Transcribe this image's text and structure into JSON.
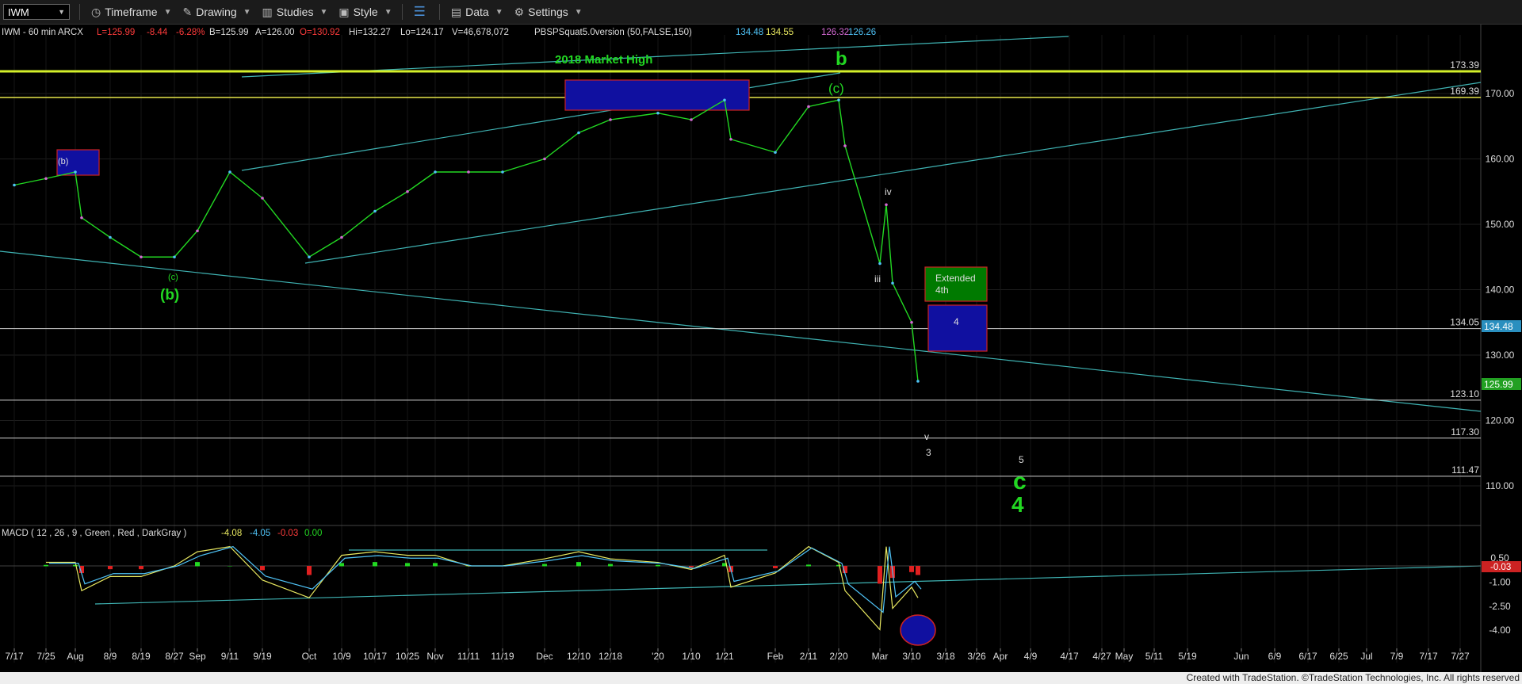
{
  "toolbar": {
    "symbol": "IWM",
    "timeframe": "Timeframe",
    "drawing": "Drawing",
    "studies": "Studies",
    "style": "Style",
    "data": "Data",
    "settings": "Settings"
  },
  "header": {
    "symbol_info": "IWM - 60 min  ARCX",
    "last": "L=125.99",
    "change": "-8.44",
    "pct": "-6.28%",
    "bid": "B=125.99",
    "ask": "A=126.00",
    "open": "O=130.92",
    "high": "Hi=132.27",
    "low": "Lo=124.17",
    "volume": "V=46,678,072",
    "study": "PBSPSquat5.0version (50,FALSE,150)",
    "v1": "134.48",
    "v2": "134.55",
    "v3": "126.32",
    "v4": "126.26"
  },
  "annotations": {
    "market_high": "2018 Market High",
    "b": "b",
    "c_paren": "(c)",
    "b_paren_small": "(b)",
    "c_small": "(c)",
    "b_paren_big": "(b)",
    "iv": "iv",
    "iii": "iii",
    "v": "v",
    "three": "3",
    "five": "5",
    "c_big": "c",
    "four_big": "4",
    "extended": "Extended",
    "fourth": "4th",
    "four_box": "4"
  },
  "level_labels": [
    "173.39",
    "169.39",
    "134.05",
    "123.10",
    "117.30",
    "111.47"
  ],
  "current_price": "125.99",
  "ref_price": "134.48",
  "macd": {
    "header": "MACD ( 12 , 26 , 9 , Green , Red , DarkGray )",
    "v1": "-4.08",
    "v2": "-4.05",
    "v3": "-0.03",
    "v4": "0.00",
    "current": "-0.03",
    "axis": [
      "0.50",
      "-1.00",
      "-2.50",
      "-4.00"
    ]
  },
  "footer": "Created with TradeStation. ©TradeStation Technologies, Inc. All rights reserved",
  "chart_data": {
    "type": "line",
    "symbol": "IWM",
    "interval": "60 min",
    "ylim": [
      105,
      178
    ],
    "y_ticks": [
      110,
      120,
      130,
      140,
      150,
      160,
      170
    ],
    "y_tick_labels": [
      "110.00",
      "120.00",
      "130.00",
      "140.00",
      "150.00",
      "160.00",
      "170.00"
    ],
    "x_tick_labels": [
      "7/17",
      "7/25",
      "Aug",
      "8/9",
      "8/19",
      "8/27",
      "Sep",
      "9/11",
      "9/19",
      "Oct",
      "10/9",
      "10/17",
      "10/25",
      "Nov",
      "11/11",
      "11/19",
      "Dec",
      "12/10",
      "12/18",
      "'20",
      "1/10",
      "1/21",
      "Feb",
      "2/11",
      "2/20",
      "Mar",
      "3/10",
      "3/18",
      "3/26",
      "Apr",
      "4/9",
      "4/17",
      "4/27",
      "May",
      "5/11",
      "5/19",
      "Jun",
      "6/9",
      "6/17",
      "6/25",
      "Jul",
      "7/9",
      "7/17",
      "7/27"
    ],
    "horizontal_levels": [
      173.39,
      169.39,
      134.05,
      123.1,
      117.3,
      111.47
    ],
    "price_path": [
      {
        "x": "7/17",
        "y": 156
      },
      {
        "x": "7/25",
        "y": 157
      },
      {
        "x": "Aug",
        "y": 158
      },
      {
        "x": "Aug",
        "y": 151
      },
      {
        "x": "8/9",
        "y": 148
      },
      {
        "x": "8/19",
        "y": 145
      },
      {
        "x": "8/27",
        "y": 145
      },
      {
        "x": "Sep",
        "y": 149
      },
      {
        "x": "9/11",
        "y": 158
      },
      {
        "x": "9/19",
        "y": 154
      },
      {
        "x": "Oct",
        "y": 145
      },
      {
        "x": "10/9",
        "y": 148
      },
      {
        "x": "10/17",
        "y": 152
      },
      {
        "x": "10/25",
        "y": 155
      },
      {
        "x": "Nov",
        "y": 158
      },
      {
        "x": "11/11",
        "y": 158
      },
      {
        "x": "11/19",
        "y": 158
      },
      {
        "x": "Dec",
        "y": 160
      },
      {
        "x": "12/10",
        "y": 164
      },
      {
        "x": "12/18",
        "y": 166
      },
      {
        "x": "'20",
        "y": 167
      },
      {
        "x": "1/10",
        "y": 166
      },
      {
        "x": "1/21",
        "y": 169
      },
      {
        "x": "1/21",
        "y": 163
      },
      {
        "x": "Feb",
        "y": 161
      },
      {
        "x": "2/11",
        "y": 168
      },
      {
        "x": "2/20",
        "y": 169
      },
      {
        "x": "2/20",
        "y": 162
      },
      {
        "x": "Mar",
        "y": 144
      },
      {
        "x": "Mar",
        "y": 153
      },
      {
        "x": "Mar",
        "y": 141
      },
      {
        "x": "3/10",
        "y": 135
      },
      {
        "x": "3/10",
        "y": 126
      }
    ],
    "macd": {
      "params": [
        12,
        26,
        9
      ],
      "values": [
        -4.08,
        -4.05,
        -0.03,
        0.0
      ],
      "ylim": [
        -4.5,
        1.2
      ],
      "y_ticks": [
        0.5,
        -1.0,
        -2.5,
        -4.0
      ]
    }
  }
}
